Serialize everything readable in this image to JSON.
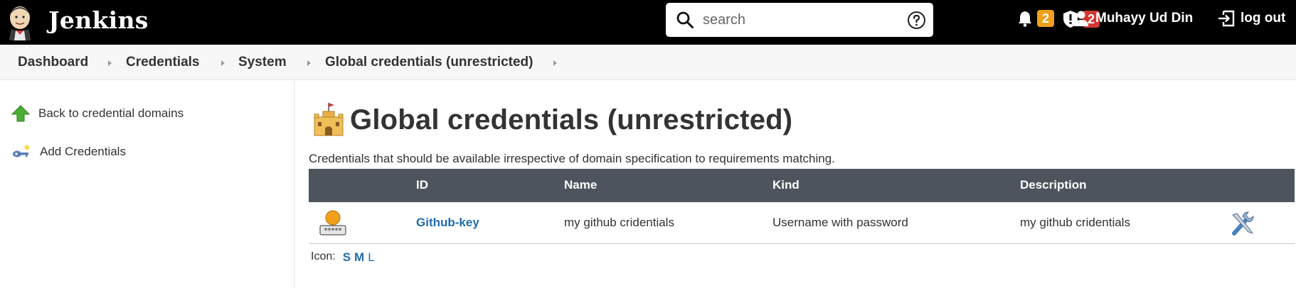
{
  "header": {
    "app_name": "Jenkins",
    "search": {
      "placeholder": "search",
      "value": ""
    },
    "notifications_count": "2",
    "security_count": "2",
    "user_name": "Muhayy Ud Din",
    "logout_label": "log out",
    "colors": {
      "background": "#000000",
      "notification_badge": "#f0a01a",
      "security_badge": "#d33833"
    }
  },
  "breadcrumb": {
    "items": [
      "Dashboard",
      "Credentials",
      "System",
      "Global credentials (unrestricted)"
    ]
  },
  "sidebar": {
    "items": [
      {
        "label": "Back to credential domains",
        "icon": "up-arrow-icon"
      },
      {
        "label": "Add Credentials",
        "icon": "key-icon"
      }
    ]
  },
  "main": {
    "title": "Global credentials (unrestricted)",
    "subtitle": "Credentials that should be available irrespective of domain specification to requirements matching.",
    "table": {
      "columns": [
        "ID",
        "Name",
        "Kind",
        "Description"
      ],
      "rows": [
        {
          "id": "Github-key",
          "name": "my github cridentials",
          "kind": "Username with password",
          "description": "my github cridentials"
        }
      ]
    },
    "icon_size": {
      "label": "Icon:",
      "options": [
        "S",
        "M",
        "L"
      ],
      "selected": "L"
    },
    "colors": {
      "table_header": "#4d545d",
      "link": "#1f6dad"
    }
  }
}
